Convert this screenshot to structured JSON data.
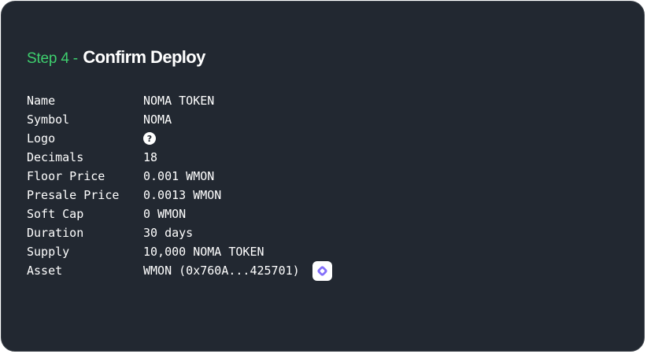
{
  "header": {
    "step": "Step 4 -",
    "title": "Confirm Deploy"
  },
  "rows": {
    "name": {
      "label": "Name",
      "value": "NOMA TOKEN"
    },
    "symbol": {
      "label": "Symbol",
      "value": "NOMA"
    },
    "logo": {
      "label": "Logo",
      "icon": "question-mark-icon",
      "glyph": "?"
    },
    "decimals": {
      "label": "Decimals",
      "value": "18"
    },
    "floor_price": {
      "label": "Floor Price",
      "value": "0.001 WMON"
    },
    "presale_price": {
      "label": "Presale Price",
      "value": "0.0013 WMON"
    },
    "soft_cap": {
      "label": "Soft Cap",
      "value": "0 WMON"
    },
    "duration": {
      "label": "Duration",
      "value": "30 days"
    },
    "supply": {
      "label": "Supply",
      "value": "10,000 NOMA TOKEN"
    },
    "asset": {
      "label": "Asset",
      "value": "WMON (0x760A...425701)",
      "icon": "monad-logo-icon"
    }
  },
  "colors": {
    "background": "#222831",
    "accent": "#3ecf6e",
    "text": "#ffffff",
    "asset_icon": "#836ef9"
  }
}
